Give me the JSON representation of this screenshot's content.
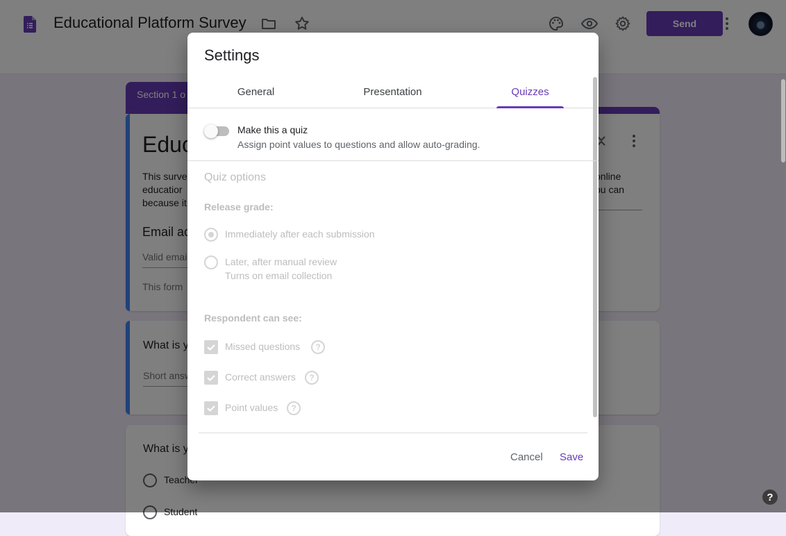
{
  "header": {
    "doc_title": "Educational Platform Survey",
    "send_label": "Send",
    "icons": [
      "forms-doc-icon",
      "folder-icon",
      "star-icon",
      "palette-icon",
      "preview-eye-icon",
      "gear-icon",
      "more-vert-icon"
    ]
  },
  "form_background": {
    "section_label": "Section 1 o",
    "title_partial": "Educ",
    "desc_left": [
      "This surve",
      "educatior",
      "because it"
    ],
    "desc_right": [
      "online",
      "ou can"
    ],
    "email_label": "Email ac",
    "email_placeholder": "Valid emai",
    "form_note": "This form",
    "q1_partial": "What is y",
    "q1_answer": "Short answ",
    "q2_partial": "What is y",
    "q2_options": [
      "Teacher",
      "Student"
    ]
  },
  "dialog": {
    "title": "Settings",
    "tabs": [
      {
        "label": "General",
        "active": false
      },
      {
        "label": "Presentation",
        "active": false
      },
      {
        "label": "Quizzes",
        "active": true
      }
    ],
    "quiz_toggle": {
      "label": "Make this a quiz",
      "description": "Assign point values to questions and allow auto-grading.",
      "on": false
    },
    "quiz_options_heading": "Quiz options",
    "release_grade": {
      "heading": "Release grade:",
      "options": [
        {
          "label": "Immediately after each submission",
          "sub": "",
          "selected": true
        },
        {
          "label": "Later, after manual review",
          "sub": "Turns on email collection",
          "selected": false
        }
      ]
    },
    "respondent_can_see": {
      "heading": "Respondent can see:",
      "items": [
        {
          "label": "Missed questions",
          "checked": true
        },
        {
          "label": "Correct answers",
          "checked": true
        },
        {
          "label": "Point values",
          "checked": true
        }
      ]
    },
    "buttons": {
      "cancel": "Cancel",
      "save": "Save"
    }
  },
  "help_fab": "?"
}
